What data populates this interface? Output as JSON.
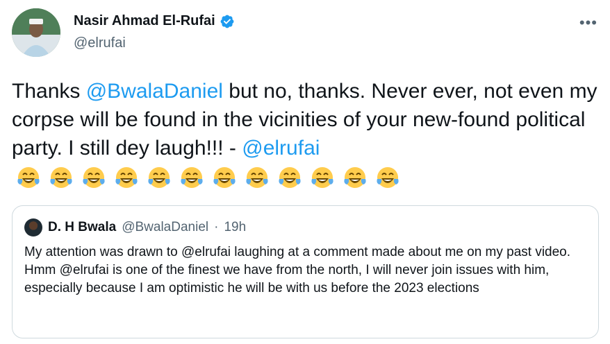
{
  "author": {
    "display_name": "Nasir Ahmad El-Rufai",
    "handle": "@elrufai",
    "verified_icon": "verified-badge-icon"
  },
  "menu": {
    "more_label": "•••"
  },
  "tweet": {
    "text_1": "Thanks ",
    "mention_1": "@BwalaDaniel",
    "text_2": " but no, thanks. Never ever, not even my corpse will be found in the vicinities of your new-found political party. I still dey laugh!!! - ",
    "mention_2": "@elrufai",
    "emoji_count_icon": "tears-of-joy-emoji",
    "emoji_count": 12
  },
  "quoted": {
    "display_name": "D. H Bwala",
    "handle": "@BwalaDaniel",
    "separator": "·",
    "time": "19h",
    "text": "My attention was drawn to @elrufai laughing at a comment made about me on my past video. Hmm @elrufai  is one of the finest we have from the north, I will never join issues with him, especially because I am optimistic he will be with us before the 2023 elections"
  },
  "colors": {
    "accent": "#1d9bf0",
    "muted": "#536471",
    "border": "#cfd9de"
  }
}
